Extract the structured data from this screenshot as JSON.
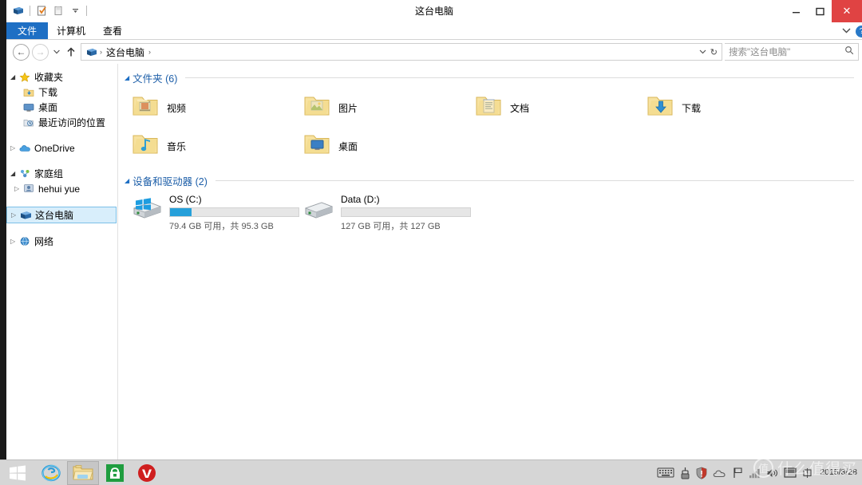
{
  "window": {
    "title": "这台电脑",
    "quick_access": [
      {
        "name": "system-menu-icon",
        "label": "这台电脑"
      },
      {
        "name": "properties-icon",
        "label": "属性"
      },
      {
        "name": "new-folder-icon",
        "label": "新建文件夹"
      },
      {
        "name": "customize-qat-icon",
        "label": "自定义快速访问工具栏"
      }
    ],
    "controls": {
      "minimize": "—",
      "maximize": "□",
      "close": "✕"
    }
  },
  "ribbon": {
    "tabs": [
      {
        "label": "文件",
        "active": true
      },
      {
        "label": "计算机",
        "active": false
      },
      {
        "label": "查看",
        "active": false
      }
    ],
    "expand_chevron": "⌄",
    "help": "?"
  },
  "address": {
    "back": "←",
    "forward": "→",
    "history_dropdown": "⌄",
    "up": "↑",
    "crumbs": [
      "这台电脑"
    ],
    "separator": "›",
    "dropdown": "⌄",
    "refresh": "↻"
  },
  "search": {
    "placeholder": "搜索\"这台电脑\"",
    "icon": "search-icon"
  },
  "sidebar": {
    "items": [
      {
        "label": "收藏夹",
        "icon": "star-icon",
        "level": 0,
        "expanded": true,
        "selected": false
      },
      {
        "label": "下载",
        "icon": "downloads-folder-icon",
        "level": 1,
        "expanded": null,
        "selected": false
      },
      {
        "label": "桌面",
        "icon": "desktop-icon",
        "level": 1,
        "expanded": null,
        "selected": false
      },
      {
        "label": "最近访问的位置",
        "icon": "recent-places-icon",
        "level": 1,
        "expanded": null,
        "selected": false
      },
      {
        "label": "OneDrive",
        "icon": "onedrive-cloud-icon",
        "level": 0,
        "expanded": false,
        "selected": false
      },
      {
        "label": "家庭组",
        "icon": "homegroup-icon",
        "level": 0,
        "expanded": true,
        "selected": false
      },
      {
        "label": "hehui yue",
        "icon": "user-icon",
        "level": 1,
        "expanded": false,
        "selected": false
      },
      {
        "label": "这台电脑",
        "icon": "this-pc-icon",
        "level": 0,
        "expanded": false,
        "selected": true
      },
      {
        "label": "网络",
        "icon": "network-icon",
        "level": 0,
        "expanded": false,
        "selected": false
      }
    ]
  },
  "content": {
    "folders_group": {
      "title": "文件夹 (6)",
      "items": [
        {
          "name": "视频",
          "icon": "videos-folder-icon"
        },
        {
          "name": "图片",
          "icon": "pictures-folder-icon"
        },
        {
          "name": "文档",
          "icon": "documents-folder-icon"
        },
        {
          "name": "下载",
          "icon": "downloads-folder-icon"
        },
        {
          "name": "音乐",
          "icon": "music-folder-icon"
        },
        {
          "name": "桌面",
          "icon": "desktop-folder-icon"
        }
      ]
    },
    "drives_group": {
      "title": "设备和驱动器 (2)",
      "items": [
        {
          "name": "OS (C:)",
          "icon": "windows-drive-icon",
          "capacity_text": "79.4 GB 可用，共 95.3 GB",
          "used_percent": 17,
          "bar_color": "#26a0da"
        },
        {
          "name": "Data (D:)",
          "icon": "hard-drive-icon",
          "capacity_text": "127 GB 可用，共 127 GB",
          "used_percent": 0,
          "bar_color": "#26a0da"
        }
      ]
    }
  },
  "taskbar": {
    "start": {
      "name": "start-button",
      "label": "开始"
    },
    "buttons": [
      {
        "name": "internet-explorer-icon",
        "label": "Internet Explorer",
        "active": false
      },
      {
        "name": "file-explorer-icon",
        "label": "文件资源管理器",
        "active": true
      },
      {
        "name": "windows-store-icon",
        "label": "应用商店",
        "active": false
      },
      {
        "name": "vivaldi-icon",
        "label": "V",
        "active": false
      }
    ],
    "tray": [
      {
        "name": "touch-keyboard-icon",
        "label": "触摸键盘"
      },
      {
        "name": "usb-eject-icon",
        "label": "安全删除硬件"
      },
      {
        "name": "security-shield-icon",
        "label": "操作中心"
      },
      {
        "name": "onedrive-tray-icon",
        "label": "OneDrive"
      },
      {
        "name": "flag-icon",
        "label": "操作中心标志"
      },
      {
        "name": "network-signal-icon",
        "label": "网络"
      },
      {
        "name": "volume-icon",
        "label": "音量"
      },
      {
        "name": "ime-icon",
        "label": "输入法"
      },
      {
        "name": "ime-mode-icon",
        "label": "中"
      }
    ],
    "date": "2015/3/28"
  },
  "watermark": {
    "logo_char": "值",
    "text": "什么值得买"
  },
  "desktop": {
    "ghost_label": "这台电脑"
  }
}
